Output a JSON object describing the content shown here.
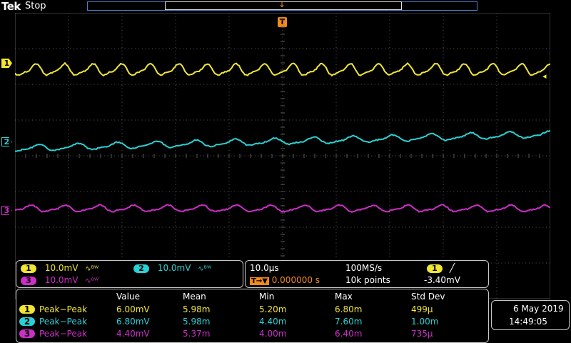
{
  "header": {
    "brand": "Tek",
    "acq_state": "Stop",
    "trigger_position_marker": "T",
    "trigger_level_marker": "◂"
  },
  "colors": {
    "ch1": "#f0e633",
    "ch2": "#2ad1d4",
    "ch3": "#cc2ec8",
    "trigger": "#f08a1c",
    "grid": "#5a5a5a"
  },
  "channels": [
    {
      "num": "1",
      "scale": "10.0mV",
      "bw_icon": "∿ᴮᵂ"
    },
    {
      "num": "2",
      "scale": "10.0mV",
      "bw_icon": "∿ᴮᵂ"
    },
    {
      "num": "3",
      "scale": "10.0mV",
      "bw_icon": "∿ᴮᵂ"
    }
  ],
  "horizontal": {
    "time_div": "10.0μs",
    "sample_rate": "100MS/s",
    "trig_delay": "0.000000 s",
    "record_length": "10k points",
    "trig_source": "1",
    "trig_slope_icon": "╱",
    "trig_level": "-3.40mV"
  },
  "measurements": {
    "headers": [
      "Value",
      "Mean",
      "Min",
      "Max",
      "Std Dev"
    ],
    "rows": [
      {
        "ch": "1",
        "name": "Peak−Peak",
        "value": "6.00mV",
        "mean": "5.98m",
        "min": "5.20m",
        "max": "6.80m",
        "std": "499μ"
      },
      {
        "ch": "2",
        "name": "Peak−Peak",
        "value": "6.80mV",
        "mean": "5.98m",
        "min": "4.40m",
        "max": "7.60m",
        "std": "1.00m"
      },
      {
        "ch": "3",
        "name": "Peak−Peak",
        "value": "4.40mV",
        "mean": "5.37m",
        "min": "4.00m",
        "max": "6.40m",
        "std": "735μ"
      }
    ]
  },
  "datetime": {
    "date": "6 May 2019",
    "time": "14:49:05"
  }
}
